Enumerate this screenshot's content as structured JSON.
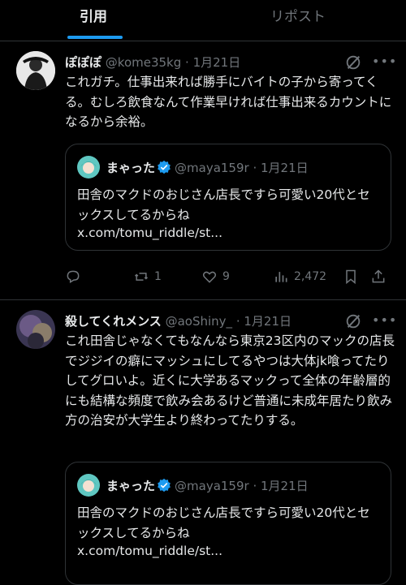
{
  "tabs": [
    {
      "label": "引用",
      "active": true
    },
    {
      "label": "リポスト",
      "active": false
    }
  ],
  "posts": [
    {
      "name": "ぽぽぽ",
      "handle": "@kome35kg",
      "date": "· 1月21日",
      "body": "これガチ。仕事出来れば勝手にバイトの子から寄ってくる。むしろ飲食なんて作業早ければ仕事出来るカウントになるから余裕。",
      "quote": {
        "name": "まゃった",
        "handle": "@maya159r",
        "date": "· 1月21日",
        "body": "田舎のマクドのおじさん店長ですら可愛い20代とセックスしてるからね",
        "link": "x.com/tomu_riddle/st..."
      },
      "replies": "",
      "reposts": "1",
      "likes": "9",
      "views": "2,472"
    },
    {
      "name": "殺してくれメンス",
      "handle": "@aoShiny_",
      "date": "· 1月21日",
      "body": "これ田舎じゃなくてもなんなら東京23区内のマックの店長でジジイの癖にマッシュにしてるやつは大体jk喰ってたりしてグロいよ。近くに大学あるマックって全体の年齢層的にも結構な頻度で飲み会あるけど普通に未成年居たり飲み方の治安が大学生より終わってたりする。",
      "quote": {
        "name": "まゃった",
        "handle": "@maya159r",
        "date": "· 1月21日",
        "body": "田舎のマクドのおじさん店長ですら可愛い20代とセックスしてるからね",
        "link": "x.com/tomu_riddle/st..."
      }
    }
  ],
  "icons": [
    "grok-icon",
    "more-icon",
    "reply-icon",
    "repost-icon",
    "like-icon",
    "views-icon",
    "bookmark-icon",
    "share-icon",
    "verified-badge-icon"
  ],
  "colors": {
    "accent": "#1d9bf0",
    "muted": "#71767b",
    "text": "#e7e9ea",
    "border": "#2f3336",
    "background": "#000000"
  }
}
